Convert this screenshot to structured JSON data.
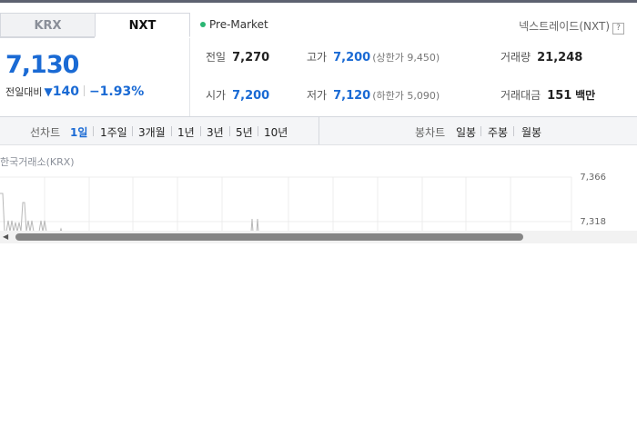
{
  "tabs": {
    "krx": "KRX",
    "nxt": "NXT"
  },
  "status": {
    "market": "Pre-Market",
    "market_color": "#2bb673"
  },
  "exchange": {
    "label": "넥스트레이드(NXT)",
    "help": "?"
  },
  "quote": {
    "price": "7,130",
    "change_label": "전일대비",
    "change_arrow": "▼",
    "change_value": "140",
    "change_pct": "−1.93%",
    "color": "#1a6ad4"
  },
  "stats": {
    "prev_close": {
      "label": "전일",
      "value": "7,270"
    },
    "open": {
      "label": "시가",
      "value": "7,200"
    },
    "high": {
      "label": "고가",
      "value": "7,200",
      "sub": "(상한가 9,450)"
    },
    "low": {
      "label": "저가",
      "value": "7,120",
      "sub": "(하한가 5,090)"
    },
    "volume": {
      "label": "거래량",
      "value": "21,248"
    },
    "amount": {
      "label": "거래대금",
      "value": "151",
      "unit": "백만"
    }
  },
  "line_chart_periods": {
    "label": "선차트",
    "items": [
      "1일",
      "1주일",
      "3개월",
      "1년",
      "3년",
      "5년",
      "10년"
    ],
    "active": "1일"
  },
  "candle_chart_periods": {
    "label": "봉차트",
    "items": [
      "일봉",
      "주봉",
      "월봉"
    ]
  },
  "chart": {
    "source": "한국거래소(KRX)",
    "y_ticks": [
      "7,366",
      "7,318"
    ]
  },
  "scrollbar": {
    "left_arrow": "◀"
  }
}
